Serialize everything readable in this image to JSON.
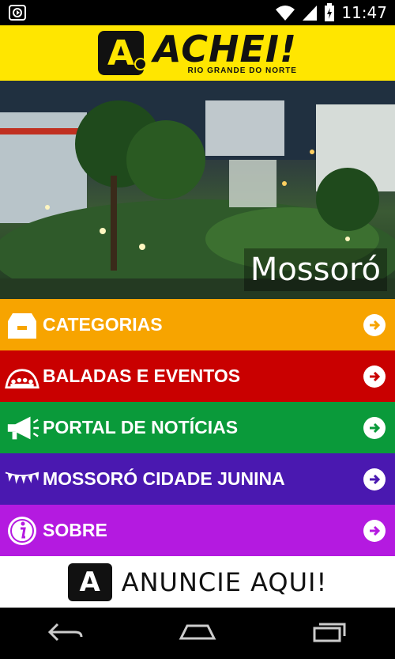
{
  "status_bar": {
    "time": "11:47"
  },
  "header": {
    "logo_title": "ACHEI!",
    "logo_subtitle": "RIO GRANDE DO NORTE"
  },
  "hero": {
    "caption": "Mossoró"
  },
  "menu": [
    {
      "label": "CATEGORIAS",
      "color": "#f7a400",
      "icon": "archive-box-icon"
    },
    {
      "label": "BALADAS E EVENTOS",
      "color": "#c90000",
      "icon": "crowd-icon"
    },
    {
      "label": "PORTAL DE NOTÍCIAS",
      "color": "#0a9a3a",
      "icon": "megaphone-icon"
    },
    {
      "label": "MOSSORÓ CIDADE JUNINA",
      "color": "#4a18b0",
      "icon": "bunting-flags-icon"
    },
    {
      "label": "SOBRE",
      "color": "#b41ae0",
      "icon": "info-icon"
    }
  ],
  "ad": {
    "label": "ANUNCIE AQUI!"
  }
}
